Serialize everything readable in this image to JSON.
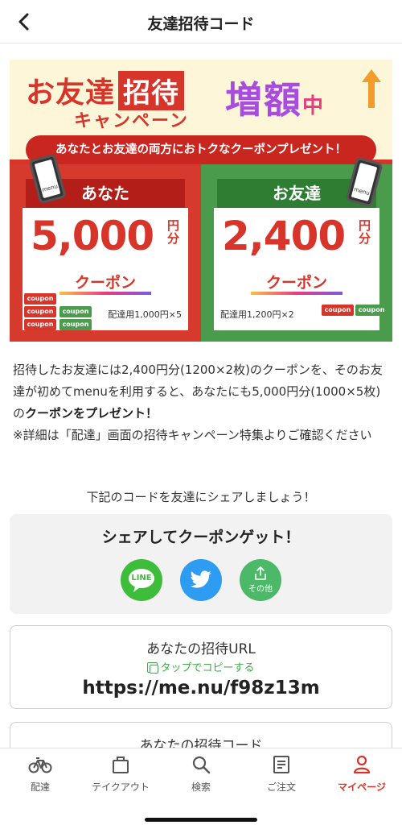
{
  "header": {
    "title": "友達招待コード"
  },
  "banner": {
    "title_main": "お友達",
    "title_badge": "招待",
    "title_sub": "キャンペーン",
    "increase_main": "増額",
    "increase_small": "中",
    "ribbon": "あなたとお友達の両方におトクなクーポンプレゼント！",
    "you": {
      "tag": "あなた",
      "amount": "5,000",
      "unit": "円分",
      "coupon": "クーポン",
      "breakdown": "配達用1,000円×5",
      "ticket_label": "coupon"
    },
    "friend": {
      "tag": "お友達",
      "amount": "2,400",
      "unit": "円分",
      "coupon": "クーポン",
      "breakdown": "配達用1,200円×2",
      "ticket_label": "coupon"
    },
    "phone_logo": "menu"
  },
  "description": {
    "part1": "招待したお友達には2,400円分(1200×2枚)のクーポンを、そのお友達が初めてmenuを利用すると、あなたにも5,000円分(1000×5枚)の",
    "bold": "クーポンをプレゼント！",
    "part2": "※詳細は「配達」画面の招待キャンペーン特集よりご確認ください"
  },
  "share_prompt": "下記のコードを友達にシェアしましょう！",
  "share": {
    "title": "シェアしてクーポンゲット！",
    "line_label": "LINE",
    "other_label": "その他"
  },
  "invite_url": {
    "title": "あなたの招待URL",
    "copy_hint": "タップでコピーする",
    "value": "https://me.nu/f98z13m"
  },
  "invite_code": {
    "title": "あなたの招待コード"
  },
  "tabs": [
    {
      "label": "配達",
      "icon": "bicycle-icon"
    },
    {
      "label": "テイクアウト",
      "icon": "bag-icon"
    },
    {
      "label": "検索",
      "icon": "search-icon"
    },
    {
      "label": "ご注文",
      "icon": "receipt-icon"
    },
    {
      "label": "マイページ",
      "icon": "person-icon"
    }
  ],
  "colors": {
    "accent": "#d8352a",
    "green": "#4a9c4c",
    "line": "#3ebd3a",
    "twitter": "#2e9cf0"
  }
}
